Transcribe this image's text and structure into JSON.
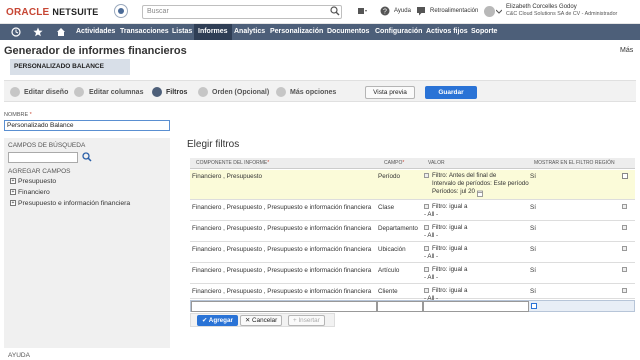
{
  "brand": {
    "oracle": "ORACLE",
    "netsuite": "NETSUITE"
  },
  "header": {
    "search_placeholder": "Buscar",
    "help_label": "Ayuda",
    "feedback_label": "Retroalimentación",
    "user_name": "Elizabeth Corcelles Godoy",
    "user_role": "C&C Cloud Solutions SA de CV - Administrador"
  },
  "nav": {
    "items": [
      {
        "label": "Actividades"
      },
      {
        "label": "Transacciones"
      },
      {
        "label": "Listas"
      },
      {
        "label": "Informes",
        "active": true
      },
      {
        "label": "Analytics"
      },
      {
        "label": "Personalización"
      },
      {
        "label": "Documentos"
      },
      {
        "label": "Configuración"
      },
      {
        "label": "Activos fijos"
      },
      {
        "label": "Soporte"
      }
    ]
  },
  "page": {
    "title": "Generador de informes financieros",
    "more": "Más",
    "subtab": "PERSONALIZADO BALANCE"
  },
  "steps": {
    "items": [
      {
        "label": "Editar diseño"
      },
      {
        "label": "Editar columnas"
      },
      {
        "label": "Filtros",
        "active": true
      },
      {
        "label": "Orden (Opcional)"
      },
      {
        "label": "Más opciones"
      }
    ],
    "preview_label": "Vista previa",
    "save_label": "Guardar"
  },
  "name_field": {
    "label": "NOMBRE",
    "required": "*",
    "value": "Personalizado Balance"
  },
  "left_panel": {
    "search_label": "CAMPOS DE BÚSQUEDA",
    "add_label": "AGREGAR CAMPOS",
    "tree": [
      {
        "label": "Presupuesto"
      },
      {
        "label": "Financiero"
      },
      {
        "label": "Presupuesto e información financiera"
      }
    ],
    "help": "AYUDA"
  },
  "filters": {
    "title": "Elegir filtros",
    "columns": {
      "component": "COMPONENTE DEL INFORME",
      "field": "CAMPO",
      "value": "VALOR",
      "show": "MOSTRAR EN EL FILTRO REGIÓN",
      "required": "*"
    },
    "rows": [
      {
        "component": "Financiero , Presupuesto",
        "field": "Período",
        "value_lines": [
          "Filtro: Antes del final de",
          "Intervalo de períodos: Este período",
          "Períodos:        jul 20"
        ],
        "show": "Sí",
        "highlight": true
      },
      {
        "component": "Financiero , Presupuesto , Presupuesto e información financiera",
        "field": "Clase",
        "value_lines": [
          "Filtro: igual a",
          "- All -"
        ],
        "show": "Sí"
      },
      {
        "component": "Financiero , Presupuesto , Presupuesto e información financiera",
        "field": "Departamento",
        "value_lines": [
          "Filtro: igual a",
          "- All -"
        ],
        "show": "Sí"
      },
      {
        "component": "Financiero , Presupuesto , Presupuesto e información financiera",
        "field": "Ubicación",
        "value_lines": [
          "Filtro: igual a",
          "- All -"
        ],
        "show": "Sí"
      },
      {
        "component": "Financiero , Presupuesto , Presupuesto e información financiera",
        "field": "Artículo",
        "value_lines": [
          "Filtro: igual a",
          "- All -"
        ],
        "show": "Sí"
      },
      {
        "component": "Financiero , Presupuesto , Presupuesto e información financiera",
        "field": "Cliente",
        "value_lines": [
          "Filtro: igual a",
          "- All -"
        ],
        "show": "Sí"
      }
    ],
    "actions": {
      "add": "Agregar",
      "cancel": "Cancelar",
      "insert": "Insertar"
    }
  }
}
